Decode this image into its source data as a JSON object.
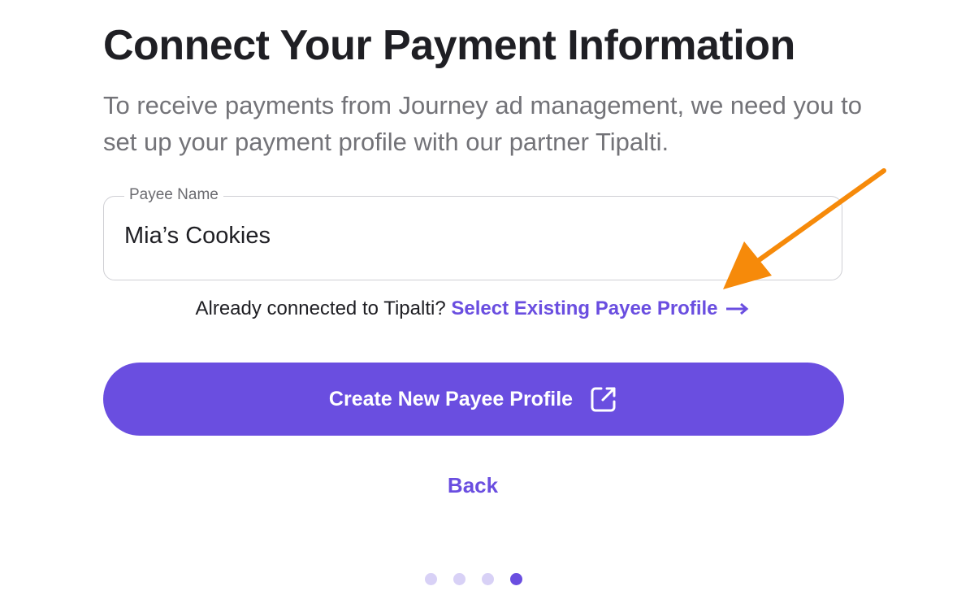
{
  "header": {
    "title": "Connect Your Payment Information",
    "subtitle": "To receive payments from Journey ad management, we need you to set up your payment profile with our partner Tipalti."
  },
  "payee_field": {
    "label": "Payee Name",
    "value": "Mia’s Cookies"
  },
  "existing": {
    "prompt": "Already connected to Tipalti?",
    "link_label": "Select Existing Payee Profile",
    "icon": "arrow-right-icon"
  },
  "create_button": {
    "label": "Create New Payee Profile",
    "icon": "external-link-icon"
  },
  "back_label": "Back",
  "stepper": {
    "total_steps": 4,
    "current_step": 4
  },
  "annotation": {
    "icon": "annotation-arrow-icon",
    "color": "#f68a0a"
  },
  "colors": {
    "accent": "#6a4ee0",
    "inactive_dot": "#d8d1f6"
  }
}
